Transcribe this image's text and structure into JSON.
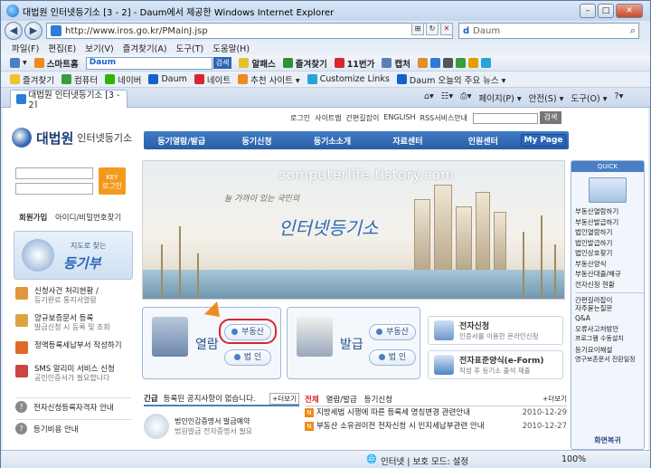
{
  "window": {
    "title": "대법원 인터넷등기소 [3 - 2] - Daum에서 제공한 Windows Internet Explorer",
    "url": "http://www.iros.go.kr/PMainJ.jsp",
    "search_provider": "Daum"
  },
  "menu": [
    "파일(F)",
    "편집(E)",
    "보기(V)",
    "즐겨찾기(A)",
    "도구(T)",
    "도움말(H)"
  ],
  "toolbar": {
    "items": [
      "스마트홈",
      "알패스",
      "즐겨찾기",
      "11번가",
      "캡처"
    ],
    "daum_search_btn": "검색",
    "daum_brand": "Daum"
  },
  "favorites_bar": {
    "favorites_label": "즐겨찾기",
    "items": [
      "컴퓨터",
      "네이버",
      "Daum",
      "네이트",
      "추천 사이트 ▾",
      "Customize Links",
      "Daum 오늘의 주요 뉴스 ▾"
    ]
  },
  "tab": {
    "label": "대법원 인터넷등기소 [3 - 2]",
    "tools": [
      "페이지(P) ▾",
      "안전(S) ▾",
      "도구(O) ▾"
    ]
  },
  "page": {
    "top_links": [
      "로그인",
      "사이트맵",
      "간편길잡이",
      "ENGLISH",
      "RSS서비스안내"
    ],
    "top_search_btn": "검색",
    "logo_main": "대법원",
    "logo_sub": "인터넷등기소",
    "gnb": [
      "등기열람/발급",
      "등기신청",
      "등기소소개",
      "자료센터",
      "인원센터",
      "My Page"
    ],
    "login_btn": "로그인",
    "login_links": [
      "회원가입",
      "아이디/비밀번호찾기"
    ],
    "map_box": {
      "small": "지도로 찾는",
      "big": "등기부"
    },
    "left_items": [
      {
        "title": "신청사건 처리현황 /",
        "sub": "등기완료 통지서열람"
      },
      {
        "title": "양규보증문서 등록",
        "sub": "발급신청 시 등록 및 조회"
      },
      {
        "title": "정액등록세납부서 작성하기",
        "sub": ""
      },
      {
        "title": "SMS 알리미 서비스 신청",
        "sub": "공인인증서가 필요합니다"
      }
    ],
    "left_bottom": [
      "전자신청등록자격자 안내",
      "등기비용 안내"
    ],
    "watermark": "computerlife.tistory.com",
    "hero_slogan": "늘 가까이 있는 국민의",
    "hero_brand": "인터넷등기소",
    "panels": {
      "view": {
        "label": "열람",
        "btn1": "부동산",
        "btn2": "법 인"
      },
      "issue": {
        "label": "발급",
        "btn1": "부동산",
        "btn2": "법 인"
      }
    },
    "services": [
      {
        "title": "전자신청",
        "sub": "인증서를 이용한 온라인신청"
      },
      {
        "title": "전자표준양식(e-Form)",
        "sub": "작성 후 등기소 출석 제출"
      }
    ],
    "quick": {
      "header": "QUICK",
      "links": [
        "부동산열람하기",
        "부동산발급하기",
        "법인열람하기",
        "법인발급하기",
        "법인상호찾기",
        "부동산양식",
        "부동산대출/해규",
        "전자신청 현황"
      ],
      "links2": [
        "간편길라잡이",
        "자주묻는질문",
        "Q&A",
        "오류사고처방안",
        "프로그램 수동설치",
        "등기요이해설",
        "영구보존문서 전환일정"
      ],
      "footer": "화면복귀"
    },
    "notice": {
      "label": "긴급",
      "title": "등록된 공지사항이 없습니다.",
      "more": "+더보기",
      "body1": "법인인감증명서 발급예약",
      "body2": "법원발급 전자증명서 필요"
    },
    "news": {
      "tabs": [
        "전체",
        "열람/발급",
        "등기신청"
      ],
      "more": "+더보기",
      "rows": [
        {
          "title": "지방세법 시행에 따른 등록세 명칭변경 관련안내",
          "date": "2010-12-29"
        },
        {
          "title": "부동산 소유권이전 전자신청 시 인지세납부관련 안내",
          "date": "2010-12-27"
        }
      ]
    }
  },
  "status": {
    "zone": "인터넷 | 보호 모드: 설정",
    "zoom": "100%"
  }
}
